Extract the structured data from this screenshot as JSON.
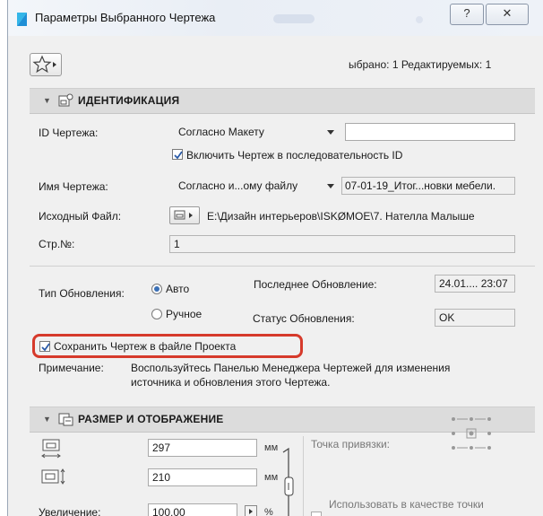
{
  "window": {
    "title": "Параметры Выбранного Чертежа",
    "help_label": "?",
    "close_label": "✕"
  },
  "toolbar": {
    "selection_info": "ыбрано: 1 Редактируемых: 1"
  },
  "identification": {
    "header": "ИДЕНТИФИКАЦИЯ",
    "id_label": "ID Чертежа:",
    "id_mode": "Согласно Макету",
    "id_value": "",
    "include_in_sequence_label": "Включить Чертеж в последовательность ID",
    "include_in_sequence": true,
    "name_label": "Имя Чертежа:",
    "name_mode": "Согласно и...ому файлу",
    "name_value": "07-01-19_Итог...новки мебели.",
    "source_label": "Исходный Файл:",
    "source_path": "E:\\Дизайн интерьеров\\ISKØMOE\\7. Нателла Малыше",
    "page_label": "Стр.№:",
    "page_value": "1"
  },
  "update": {
    "type_label": "Тип Обновления:",
    "auto_label": "Авто",
    "manual_label": "Ручное",
    "selected": "auto",
    "last_update_label": "Последнее Обновление:",
    "last_update_value": "24.01.... 23:07",
    "status_label": "Статус Обновления:",
    "status_value": "OK",
    "store_label": "Сохранить Чертеж в файле Проекта",
    "store_checked": true,
    "note_label": "Примечание:",
    "note_line1": "Воспользуйтесь Панелью Менеджера Чертежей для изменения",
    "note_line2": "источника и обновления этого Чертежа."
  },
  "size": {
    "header": "РАЗМЕР И ОТОБРАЖЕНИЕ",
    "width_value": "297",
    "height_value": "210",
    "unit": "мм",
    "scale_label": "Увеличение:",
    "scale_value": "100,00",
    "percent": "%",
    "anchor_label": "Точка привязки:",
    "use_as_label": "Использовать в качестве точки"
  },
  "icons": [
    "app-icon",
    "star-icon",
    "drawing-section-icon",
    "size-section-icon",
    "width-icon",
    "height-icon",
    "link-chain-icon",
    "file-browse-icon",
    "anchor-point-icon"
  ],
  "colors": {
    "highlight": "#d63a2b",
    "radio_accent": "#3a6fb5",
    "section_bg": "#dcdcdc"
  }
}
